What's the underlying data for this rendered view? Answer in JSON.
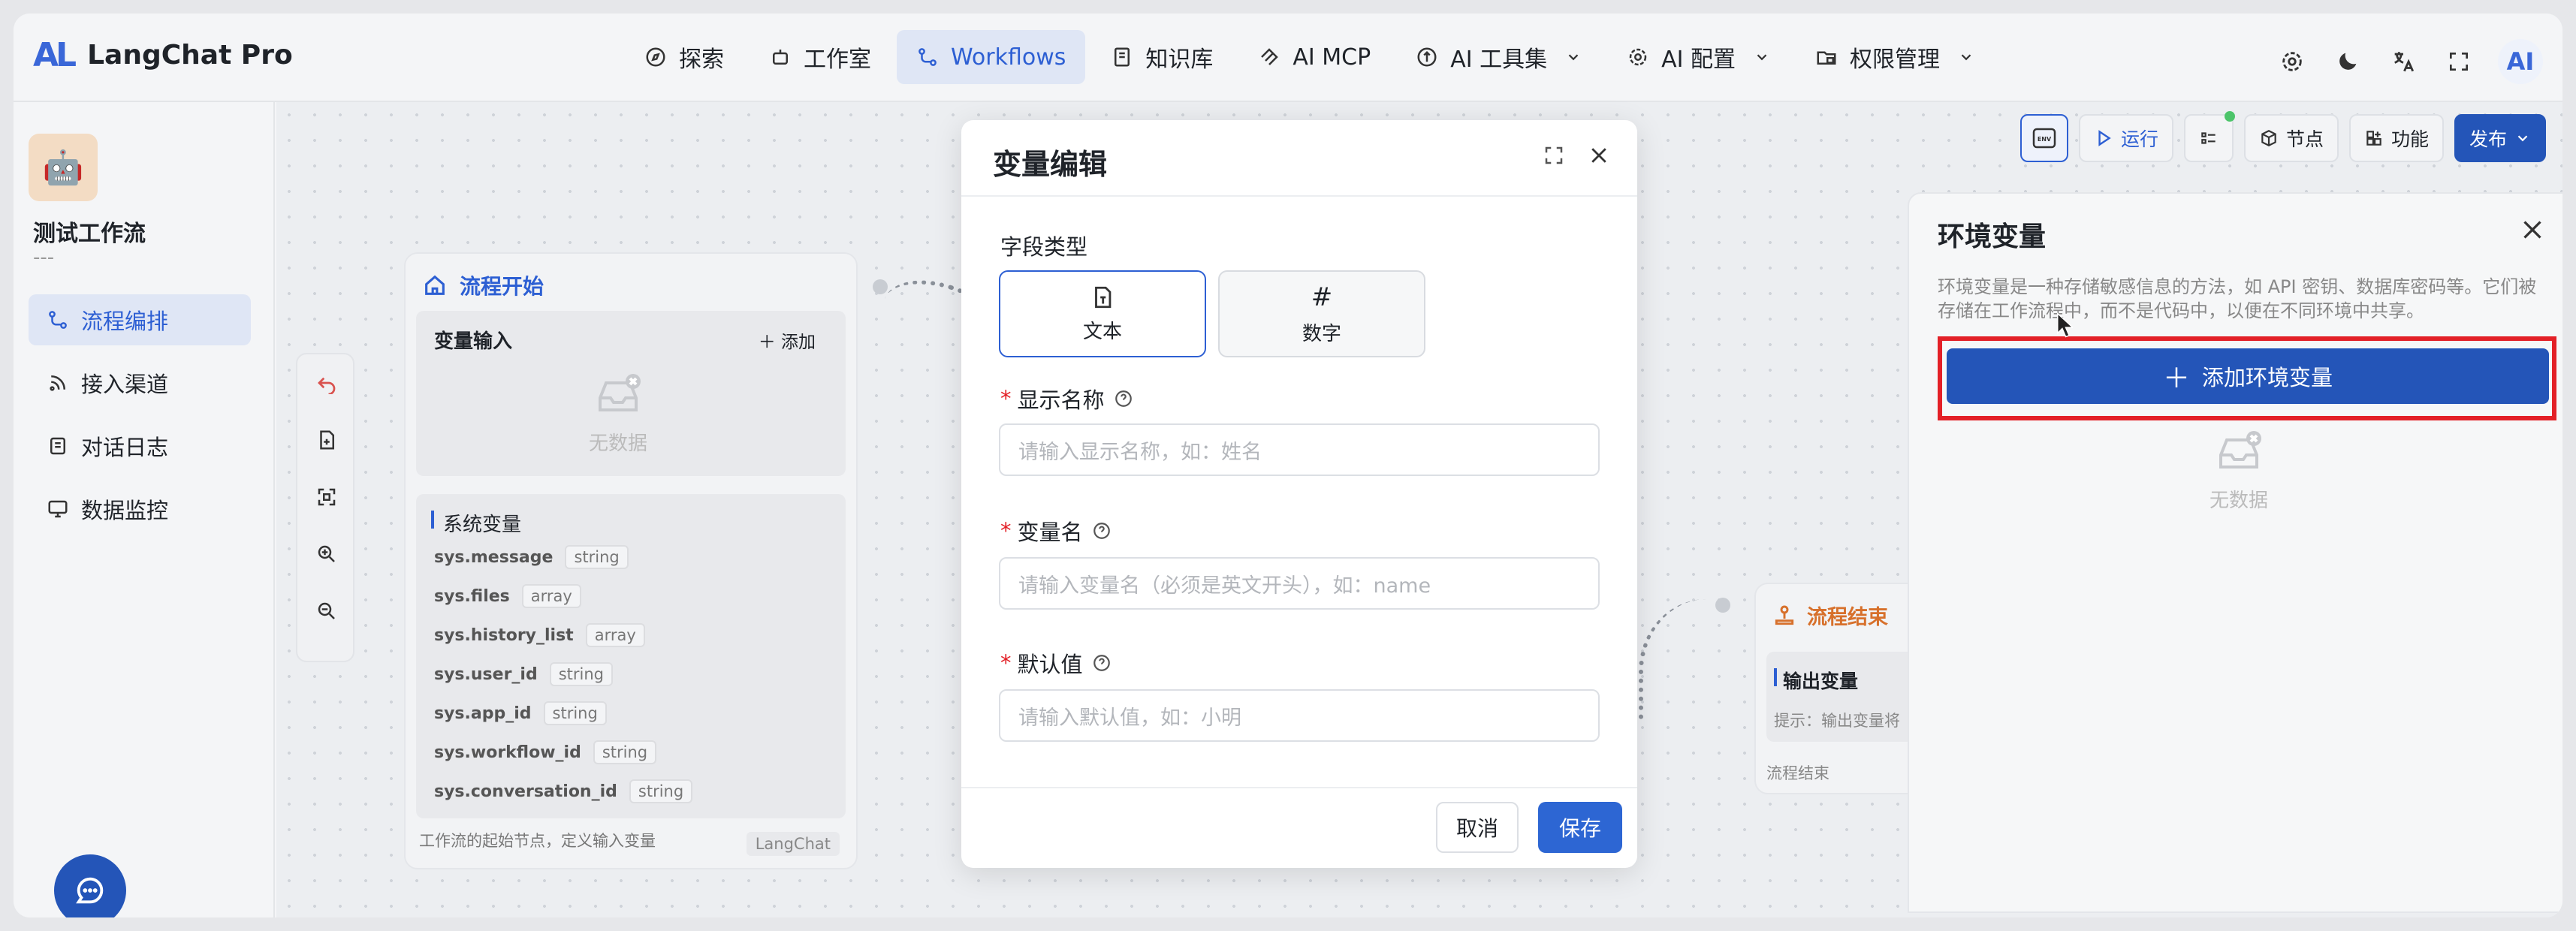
{
  "app": {
    "logo_mark": "AL",
    "name": "LangChat Pro"
  },
  "nav": [
    {
      "label": "探索",
      "icon": "compass-icon"
    },
    {
      "label": "工作室",
      "icon": "robot-icon"
    },
    {
      "label": "Workflows",
      "icon": "workflow-icon",
      "active": true
    },
    {
      "label": "知识库",
      "icon": "book-icon"
    },
    {
      "label": "AI MCP",
      "icon": "mcp-icon"
    },
    {
      "label": "AI 工具集",
      "icon": "tool-icon",
      "dropdown": true
    },
    {
      "label": "AI 配置",
      "icon": "gear-icon",
      "dropdown": true
    },
    {
      "label": "权限管理",
      "icon": "folder-lock-icon",
      "dropdown": true
    }
  ],
  "user_avatar": "AI",
  "sidebar": {
    "workflow_name": "测试工作流",
    "workflow_desc": "---",
    "items": [
      {
        "label": "流程编排",
        "active": true
      },
      {
        "label": "接入渠道"
      },
      {
        "label": "对话日志"
      },
      {
        "label": "数据监控"
      }
    ]
  },
  "canvas_toolbar": {
    "env_label": "ENV",
    "run": "运行",
    "nodes": "节点",
    "functions": "功能",
    "publish": "发布"
  },
  "start_node": {
    "title": "流程开始",
    "input_title": "变量输入",
    "add": "添加",
    "empty": "无数据",
    "sys_title": "系统变量",
    "sys_vars": [
      {
        "name": "sys.message",
        "type": "string"
      },
      {
        "name": "sys.files",
        "type": "array"
      },
      {
        "name": "sys.history_list",
        "type": "array"
      },
      {
        "name": "sys.user_id",
        "type": "string"
      },
      {
        "name": "sys.app_id",
        "type": "string"
      },
      {
        "name": "sys.workflow_id",
        "type": "string"
      },
      {
        "name": "sys.conversation_id",
        "type": "string"
      }
    ],
    "footer": "工作流的起始节点，定义输入变量",
    "footer_tag": "LangChat"
  },
  "end_node": {
    "title": "流程结束",
    "output_title": "输出变量",
    "hint": "提示：输出变量将",
    "footer": "流程结束"
  },
  "env_panel": {
    "title": "环境变量",
    "desc": "环境变量是一种存储敏感信息的方法，如 API 密钥、数据库密码等。它们被存储在工作流程中，而不是代码中，以便在不同环境中共享。",
    "add_label": "添加环境变量",
    "empty": "无数据"
  },
  "modal": {
    "title": "变量编辑",
    "field_type_label": "字段类型",
    "types": [
      {
        "label": "文本",
        "glyph": "T",
        "active": true
      },
      {
        "label": "数字",
        "glyph": "#"
      }
    ],
    "display_name": {
      "label": "显示名称",
      "placeholder": "请输入显示名称，如：姓名"
    },
    "var_name": {
      "label": "变量名",
      "placeholder": "请输入变量名（必须是英文开头），如：name"
    },
    "default_value": {
      "label": "默认值",
      "placeholder": "请输入默认值，如：小明"
    },
    "cancel": "取消",
    "save": "保存"
  }
}
